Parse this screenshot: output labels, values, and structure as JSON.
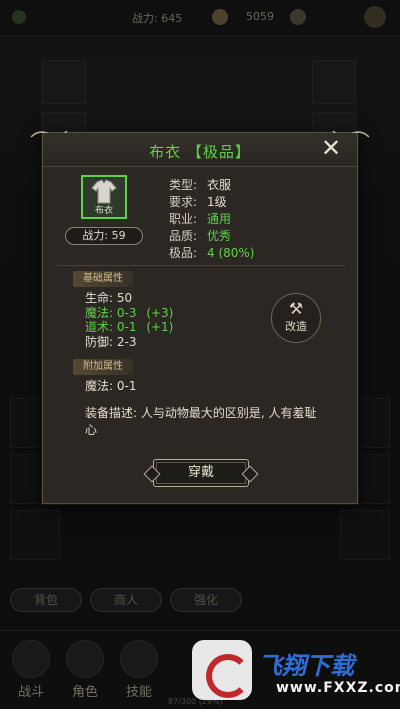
{
  "dialog": {
    "title": "布衣 【极品】",
    "close_symbol": "✕",
    "item_icon_label": "布衣",
    "power_label": "战力: 59",
    "info": [
      {
        "key": "类型:",
        "value": "衣服",
        "green": false
      },
      {
        "key": "要求:",
        "value": "1级",
        "green": false
      },
      {
        "key": "职业:",
        "value": "通用",
        "green": true
      },
      {
        "key": "品质:",
        "value": "优秀",
        "green": true
      },
      {
        "key": "极品:",
        "value": "4 (80%)",
        "green": true
      }
    ],
    "section_base": "基础属性",
    "base_stats": [
      {
        "key": "生命:",
        "value": "50",
        "bonus": "",
        "green": false
      },
      {
        "key": "魔法:",
        "value": "0-3",
        "bonus": "(+3)",
        "green": true
      },
      {
        "key": "道术:",
        "value": "0-1",
        "bonus": "(+1)",
        "green": true
      },
      {
        "key": "防御:",
        "value": "2-3",
        "bonus": "",
        "green": false
      }
    ],
    "section_extra": "附加属性",
    "extra_stats": [
      {
        "key": "魔法:",
        "value": "0-1"
      }
    ],
    "reforge_label": "改造",
    "description": "装备描述: 人与动物最大的区别是, 人有羞耻心",
    "equip_label": "穿戴"
  },
  "background": {
    "power_label": "战力: 645",
    "gold": "5059",
    "tabs": [
      "背包",
      "商人",
      "强化"
    ],
    "nav": [
      "战斗",
      "角色",
      "技能"
    ],
    "exp_text": "87/300 (29%)"
  },
  "watermark": {
    "brand": "飞翔下载",
    "url": "www.FXXZ.com"
  },
  "colors": {
    "quality_green": "#5fd14a",
    "panel_bg": "#2b2824",
    "border_gold": "#b9b09b"
  }
}
